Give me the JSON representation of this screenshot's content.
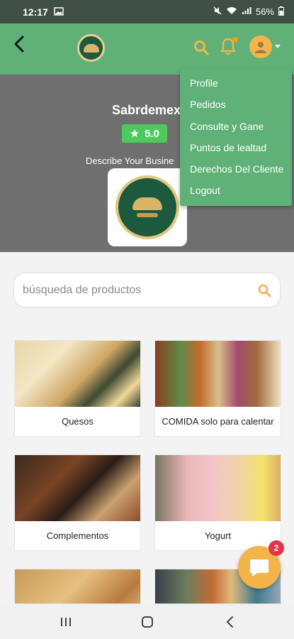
{
  "status_bar": {
    "time": "12:17",
    "battery": "56%"
  },
  "header": {
    "back_icon": "back-arrow-icon",
    "logo_icon": "restaurant-logo",
    "search_icon": "search-icon",
    "notifications_icon": "bell-icon",
    "avatar_icon": "user-avatar-icon",
    "accent_color": "#5fb177",
    "action_color": "#f3b44a"
  },
  "store": {
    "name": "Sabrdemex",
    "rating": "5.0",
    "description": "Describe Your Busine"
  },
  "dropdown": {
    "items": [
      "Profile",
      "Pedidos",
      "Consulte y Gane",
      "Puntos de lealtad",
      "Derechos Del Cliente",
      "Logout"
    ]
  },
  "search": {
    "placeholder": "búsqueda de productos"
  },
  "categories": [
    {
      "label": "Quesos"
    },
    {
      "label": "COMIDA solo para calentar"
    },
    {
      "label": "Complementos"
    },
    {
      "label": "Yogurt"
    },
    {
      "label": ""
    },
    {
      "label": ""
    }
  ],
  "chat": {
    "badge_count": "2"
  }
}
